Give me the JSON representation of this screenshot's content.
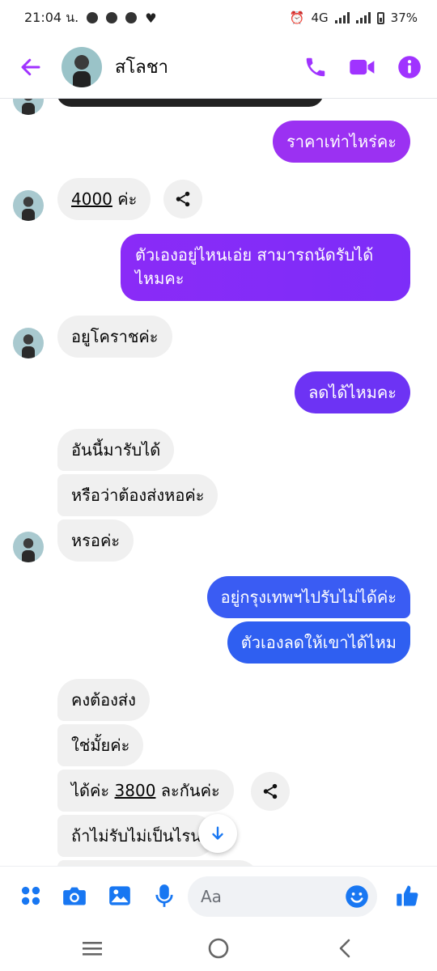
{
  "status_bar": {
    "time": "21:04 น.",
    "network": "4G",
    "battery": "37%"
  },
  "header": {
    "contact_name": "สโลชา"
  },
  "messages": {
    "m1": "ราคาเท่าไหร่คะ",
    "m2_price": "4000",
    "m2_suffix": " ค่ะ",
    "m3_line1": "ตัวเองอยู่ไหนเอ่ย สามารถนัดรับได้",
    "m3_line2": "ไหมคะ",
    "m4": "อยูโคราชค่ะ",
    "m5": "ลดได้ไหมคะ",
    "m6": "อันนี้มารับได้",
    "m7": "หรือว่าต้องส่งหอค่ะ",
    "m8": "หรอค่ะ",
    "m9": "อยู่กรุงเทพฯไปรับไม่ได้ค่ะ",
    "m10": "ตัวเองลดให้เขาได้ไหม",
    "m11": "คงต้องส่ง",
    "m12": "ใช่มั้ยค่ะ",
    "m13_prefix": "ได้ค่ะ ",
    "m13_price": "3800",
    "m13_suffix": " ละกันค่ะ",
    "m14": "ถ้าไม่รับไม่เป็นไรน"
  },
  "composer": {
    "placeholder": "Aa"
  },
  "colors": {
    "accent": "#a033ff",
    "bubble_purple": "#8f2cf5",
    "bubble_blue": "#2f5bf2",
    "incoming": "#f0f0f0"
  }
}
